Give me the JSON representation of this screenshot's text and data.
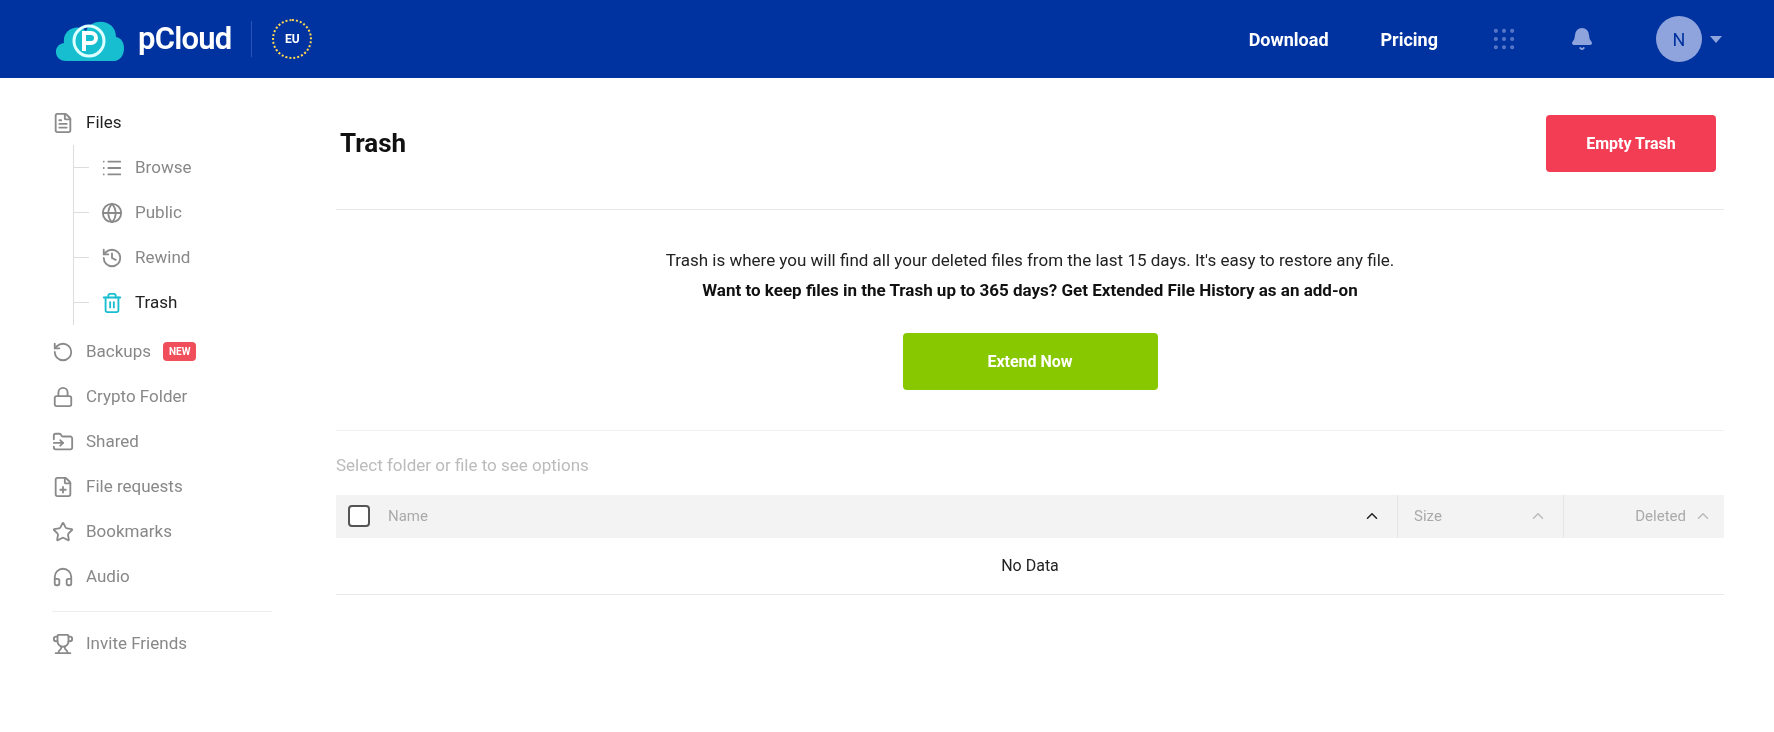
{
  "header": {
    "logo": "pCloud",
    "region": "EU",
    "links": [
      "Download",
      "Pricing"
    ],
    "avatar": "N"
  },
  "sidebar": {
    "items": [
      {
        "label": "Files",
        "kind": "file",
        "selected": true,
        "children": [
          {
            "label": "Browse",
            "kind": "list",
            "selected": false
          },
          {
            "label": "Public",
            "kind": "globe",
            "selected": false
          },
          {
            "label": "Rewind",
            "kind": "history",
            "selected": false
          },
          {
            "label": "Trash",
            "kind": "trash",
            "selected": true
          }
        ]
      },
      {
        "label": "Backups",
        "kind": "backup",
        "selected": false,
        "badge": "NEW"
      },
      {
        "label": "Crypto Folder",
        "kind": "lock",
        "selected": false
      },
      {
        "label": "Shared",
        "kind": "shared",
        "selected": false
      },
      {
        "label": "File requests",
        "kind": "request",
        "selected": false
      },
      {
        "label": "Bookmarks",
        "kind": "star",
        "selected": false
      },
      {
        "label": "Audio",
        "kind": "audio",
        "selected": false
      }
    ],
    "footer": {
      "label": "Invite Friends",
      "kind": "trophy"
    }
  },
  "page": {
    "title": "Trash",
    "action": "Empty Trash",
    "info": "Trash is where you will find all your deleted files from the last 15 days. It's easy to restore any file.",
    "promo": "Want to keep files in the Trash up to 365 days? Get Extended File History as an add-on",
    "promo_button": "Extend Now",
    "hint": "Select folder or file to see options",
    "table": {
      "select_all": {
        "checked": false
      },
      "columns": [
        "Name",
        "Size",
        "Deleted"
      ],
      "empty": "No Data"
    }
  }
}
